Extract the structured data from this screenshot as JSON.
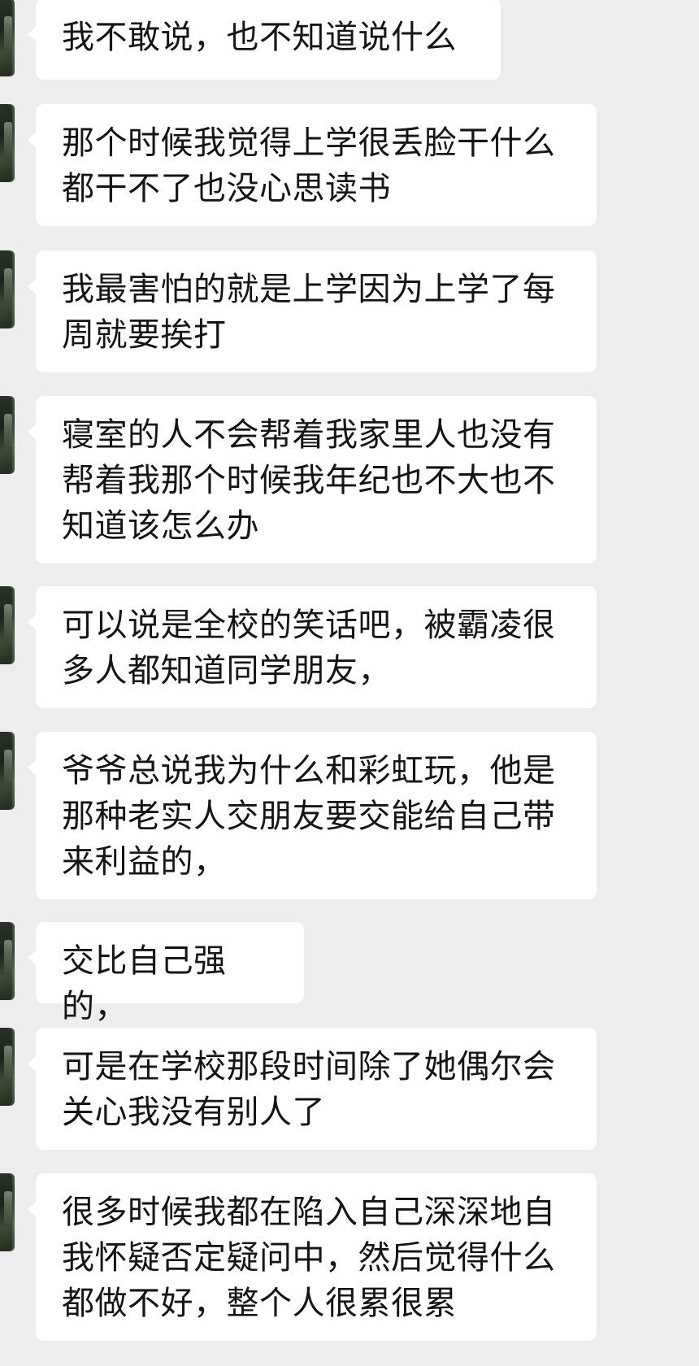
{
  "chat": {
    "messages": [
      {
        "sender": "other",
        "avatar_icon": "user-avatar-icon",
        "text": "我不敢说，也不知道说什么"
      },
      {
        "sender": "other",
        "avatar_icon": "user-avatar-icon",
        "text": "那个时候我觉得上学很丢脸干什么\n都干不了也没心思读书"
      },
      {
        "sender": "other",
        "avatar_icon": "user-avatar-icon",
        "text": "我最害怕的就是上学因为上学了每\n周就要挨打"
      },
      {
        "sender": "other",
        "avatar_icon": "user-avatar-icon",
        "text": "寝室的人不会帮着我家里人也没有\n帮着我那个时候我年纪也不大也不\n知道该怎么办"
      },
      {
        "sender": "other",
        "avatar_icon": "user-avatar-icon",
        "text": "可以说是全校的笑话吧，被霸凌很\n多人都知道同学朋友，"
      },
      {
        "sender": "other",
        "avatar_icon": "user-avatar-icon",
        "text": "爷爷总说我为什么和彩虹玩，他是\n那种老实人交朋友要交能给自己带\n来利益的，"
      },
      {
        "sender": "other",
        "avatar_icon": "user-avatar-icon",
        "text": "交比自己强的，"
      },
      {
        "sender": "other",
        "avatar_icon": "user-avatar-icon",
        "text": "可是在学校那段时间除了她偶尔会\n关心我没有别人了"
      },
      {
        "sender": "other",
        "avatar_icon": "user-avatar-icon",
        "text": "很多时候我都在陷入自己深深地自\n我怀疑否定疑问中，然后觉得什么\n都做不好，整个人很累很累"
      }
    ]
  },
  "colors": {
    "background": "#ededed",
    "bubble": "#ffffff",
    "text": "#151515"
  }
}
